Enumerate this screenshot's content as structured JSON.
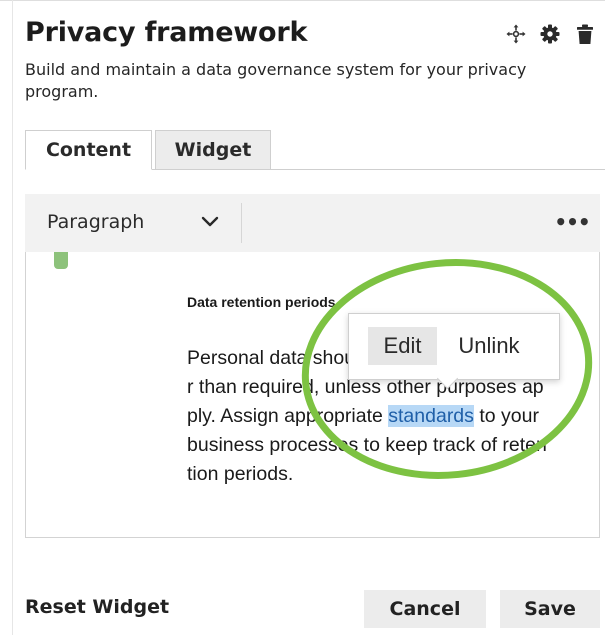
{
  "widget": {
    "title": "Privacy framework",
    "description": "Build and maintain a data governance system for your privacy program.",
    "header_icons": [
      "move-icon",
      "gear-icon",
      "trash-icon"
    ]
  },
  "tabs": [
    {
      "label": "Content",
      "active": true
    },
    {
      "label": "Widget",
      "active": false
    }
  ],
  "toolbar": {
    "block_type": "Paragraph",
    "more_label": "•••"
  },
  "editor": {
    "heading": "Data retention periods",
    "body_lines": [
      "Personal data should not be retained longe",
      "r than required, unless other purposes ap",
      "ply. Assign appropriate",
      "business processes to keep track of reten",
      "tion periods."
    ],
    "link_text": "standards",
    "after_link": " to your"
  },
  "link_popover": {
    "edit_label": "Edit",
    "unlink_label": "Unlink"
  },
  "footer": {
    "reset_label": "Reset Widget",
    "cancel_label": "Cancel",
    "save_label": "Save"
  },
  "colors": {
    "callout_ring": "#7dc242",
    "link_highlight": "#b7d8f6",
    "drag_handle": "#8dc27b"
  }
}
